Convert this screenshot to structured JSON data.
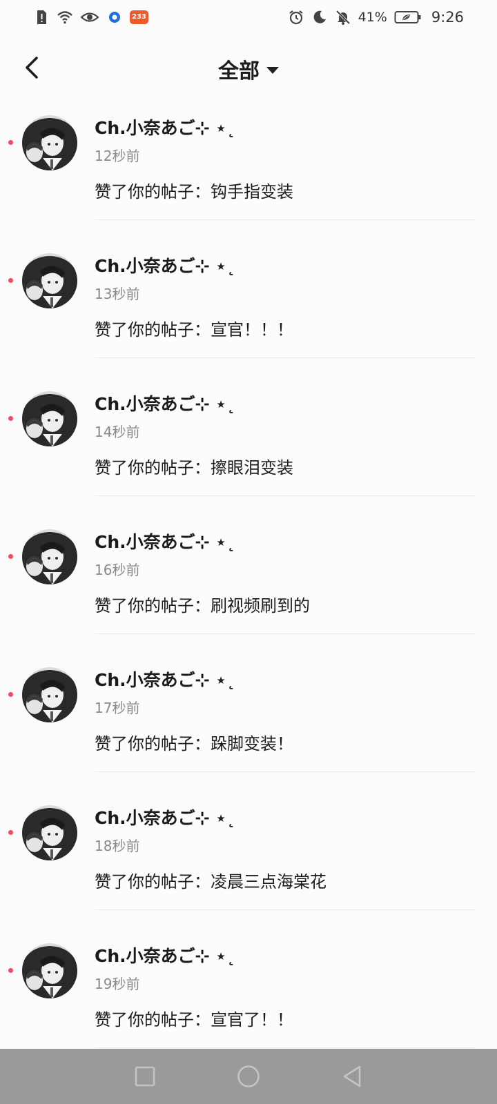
{
  "status_bar": {
    "left_icons": [
      "alert-icon",
      "wifi-icon",
      "eye-icon",
      "app-circle-icon"
    ],
    "app_badge": "233",
    "right_icons": [
      "alarm-icon",
      "moon-icon",
      "bell-off-icon"
    ],
    "battery_percent": "41%",
    "time": "9:26"
  },
  "header": {
    "back_icon": "back-arrow-icon",
    "title": "全部",
    "title_caret": "caret-down-icon"
  },
  "notifications": [
    {
      "user": "Ch.小奈あご⊹ ⋆˛",
      "time": "12秒前",
      "action": "赞了你的帖子：钩手指变装",
      "unread": true
    },
    {
      "user": "Ch.小奈あご⊹ ⋆˛",
      "time": "13秒前",
      "action": "赞了你的帖子：宣官！！！",
      "unread": true
    },
    {
      "user": "Ch.小奈あご⊹ ⋆˛",
      "time": "14秒前",
      "action": "赞了你的帖子：擦眼泪变装",
      "unread": true
    },
    {
      "user": "Ch.小奈あご⊹ ⋆˛",
      "time": "16秒前",
      "action": "赞了你的帖子：刷视频刷到的",
      "unread": true
    },
    {
      "user": "Ch.小奈あご⊹ ⋆˛",
      "time": "17秒前",
      "action": "赞了你的帖子：跺脚变装！",
      "unread": true
    },
    {
      "user": "Ch.小奈あご⊹ ⋆˛",
      "time": "18秒前",
      "action": "赞了你的帖子：凌晨三点海棠花",
      "unread": true
    },
    {
      "user": "Ch.小奈あご⊹ ⋆˛",
      "time": "19秒前",
      "action": "赞了你的帖子：宣官了！！",
      "unread": true
    }
  ],
  "nav_bar": {
    "icons": [
      "recents-square-icon",
      "home-circle-icon",
      "back-triangle-icon"
    ]
  },
  "colors": {
    "unread_dot": "#ef4a5e",
    "nav_bar_bg": "#9a9a9a",
    "badge_bg": "#ef5a2a"
  }
}
